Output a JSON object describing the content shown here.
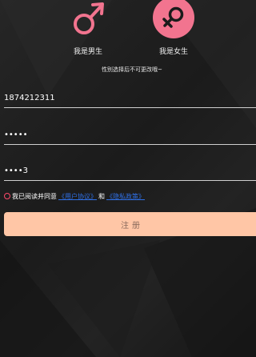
{
  "gender": {
    "male": {
      "label": "我是男生",
      "icon": "male-symbol-icon",
      "color": "#f2748f"
    },
    "female": {
      "label": "我是女生",
      "icon": "female-symbol-icon",
      "color": "#f2748f"
    },
    "hint": "性别选择后不可更改哦~"
  },
  "form": {
    "phone": {
      "value": "1874212311"
    },
    "password": {
      "value": "•••••"
    },
    "confirm_password": {
      "value": "••••3"
    }
  },
  "agreement": {
    "prefix": "我已阅读并同意",
    "user_agreement": "《用户协议》",
    "and": "和",
    "privacy_policy": "《隐私政策》"
  },
  "register_button": {
    "label": "注册",
    "color": "#ffc6a6"
  }
}
